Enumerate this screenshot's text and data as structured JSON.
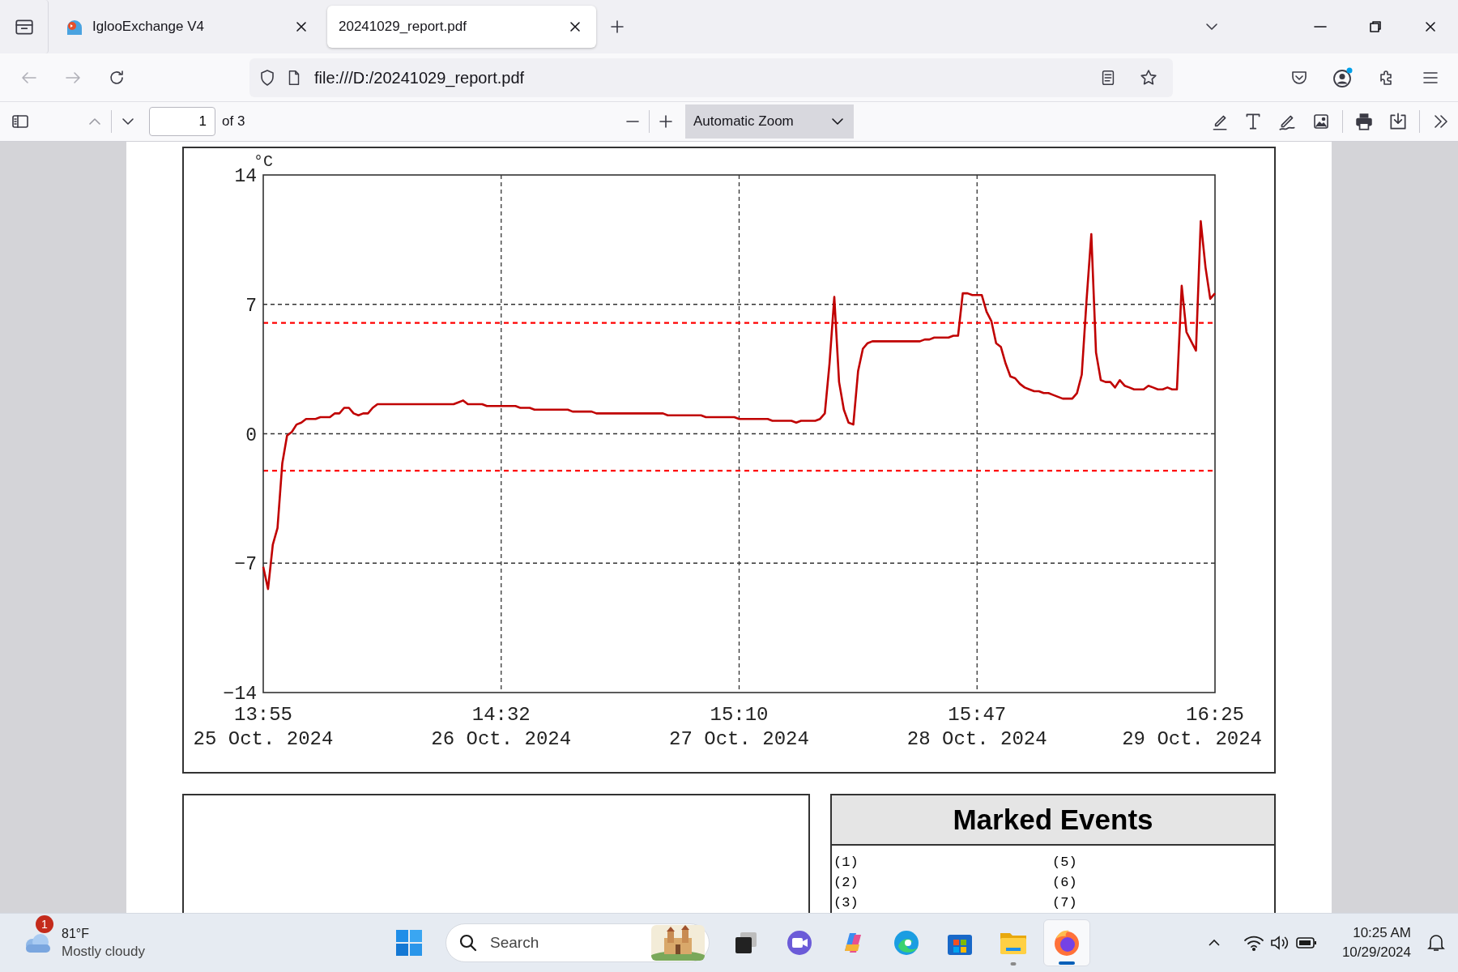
{
  "tabs": [
    {
      "kind": "igloo",
      "label": "IglooExchange V4",
      "selected": false
    },
    {
      "kind": "pdf",
      "label": "20241029_report.pdf",
      "selected": true
    }
  ],
  "address_bar": {
    "url": "file:///D:/20241029_report.pdf"
  },
  "nav": {
    "back_disabled": true,
    "forward_disabled": true
  },
  "pdf_toolbar": {
    "page": "1",
    "page_count": "of 3",
    "zoom": "Automatic Zoom"
  },
  "temperature_chart": {
    "chart_data": {
      "type": "line",
      "ylabel": "°C",
      "categories": [
        "13:55",
        null,
        null,
        null,
        null,
        null,
        null,
        null,
        null,
        null,
        null,
        null,
        null,
        null,
        null,
        null,
        null,
        null,
        null,
        null,
        null,
        null,
        null,
        null,
        null,
        null,
        null,
        null,
        null,
        null,
        null,
        null,
        null,
        null,
        null,
        null,
        null,
        null,
        null,
        null,
        null,
        null,
        null,
        null,
        null,
        null,
        null,
        null,
        null,
        null,
        "14:32",
        null,
        null,
        null,
        null,
        null,
        null,
        null,
        null,
        null,
        null,
        null,
        null,
        null,
        null,
        null,
        null,
        null,
        null,
        null,
        null,
        null,
        null,
        null,
        null,
        null,
        null,
        null,
        null,
        null,
        null,
        null,
        null,
        null,
        null,
        null,
        null,
        null,
        null,
        null,
        null,
        null,
        null,
        null,
        null,
        null,
        null,
        null,
        null,
        null,
        "15:10",
        null,
        null,
        null,
        null,
        null,
        null,
        null,
        null,
        null,
        null,
        null,
        null,
        null,
        null,
        null,
        null,
        null,
        null,
        null,
        null,
        null,
        null,
        null,
        null,
        null,
        null,
        null,
        null,
        null,
        null,
        null,
        null,
        null,
        null,
        null,
        null,
        null,
        null,
        null,
        null,
        null,
        null,
        null,
        null,
        null,
        null,
        null,
        null,
        null,
        "15:47",
        null,
        null,
        null,
        null,
        null,
        null,
        null,
        null,
        null,
        null,
        null,
        null,
        null,
        null,
        null,
        null,
        null,
        null,
        null,
        null,
        null,
        null,
        null,
        null,
        null,
        null,
        null,
        null,
        null,
        null,
        null,
        null,
        null,
        null,
        null,
        null,
        null,
        null,
        null,
        null,
        null,
        null,
        null,
        null,
        null,
        null,
        null,
        null,
        null,
        "16:25"
      ],
      "series": [
        {
          "color": "#c00000",
          "values": [
            -7.2,
            -8.4,
            -6.0,
            -5.1,
            -1.6,
            -0.1,
            0.1,
            0.5,
            0.6,
            0.8,
            0.8,
            0.8,
            0.9,
            0.9,
            0.9,
            1.1,
            1.1,
            1.4,
            1.4,
            1.1,
            1.0,
            1.1,
            1.1,
            1.4,
            1.6,
            1.6,
            1.6,
            1.6,
            1.6,
            1.6,
            1.6,
            1.6,
            1.6,
            1.6,
            1.6,
            1.6,
            1.6,
            1.6,
            1.6,
            1.6,
            1.6,
            1.7,
            1.8,
            1.6,
            1.6,
            1.6,
            1.6,
            1.5,
            1.5,
            1.5,
            1.5,
            1.5,
            1.5,
            1.5,
            1.4,
            1.4,
            1.4,
            1.3,
            1.3,
            1.3,
            1.3,
            1.3,
            1.3,
            1.3,
            1.3,
            1.2,
            1.2,
            1.2,
            1.2,
            1.2,
            1.1,
            1.1,
            1.1,
            1.1,
            1.1,
            1.1,
            1.1,
            1.1,
            1.1,
            1.1,
            1.1,
            1.1,
            1.1,
            1.1,
            1.1,
            1.0,
            1.0,
            1.0,
            1.0,
            1.0,
            1.0,
            1.0,
            1.0,
            0.9,
            0.9,
            0.9,
            0.9,
            0.9,
            0.9,
            0.9,
            0.8,
            0.8,
            0.8,
            0.8,
            0.8,
            0.8,
            0.8,
            0.7,
            0.7,
            0.7,
            0.7,
            0.7,
            0.6,
            0.7,
            0.7,
            0.7,
            0.7,
            0.8,
            1.1,
            3.8,
            7.4,
            2.8,
            1.3,
            0.6,
            0.5,
            3.4,
            4.6,
            4.9,
            5.0,
            5.0,
            5.0,
            5.0,
            5.0,
            5.0,
            5.0,
            5.0,
            5.0,
            5.0,
            5.0,
            5.1,
            5.1,
            5.2,
            5.2,
            5.2,
            5.2,
            5.3,
            5.3,
            7.6,
            7.6,
            7.5,
            7.5,
            7.5,
            6.6,
            6.1,
            4.9,
            4.7,
            3.8,
            3.1,
            3.0,
            2.7,
            2.5,
            2.4,
            2.3,
            2.3,
            2.2,
            2.2,
            2.1,
            2.0,
            1.9,
            1.9,
            1.9,
            2.2,
            3.2,
            7.2,
            10.8,
            4.4,
            2.9,
            2.8,
            2.8,
            2.5,
            2.9,
            2.6,
            2.5,
            2.4,
            2.4,
            2.4,
            2.6,
            2.5,
            2.4,
            2.4,
            2.5,
            2.4,
            2.4,
            8.0,
            5.5,
            5.0,
            4.5,
            11.5,
            9.0,
            7.3,
            7.6
          ]
        }
      ],
      "ylim": [
        -14,
        14
      ],
      "grid": true,
      "yticks": [
        {
          "value": -14,
          "label": "−14"
        },
        {
          "value": -7,
          "label": "−7"
        },
        {
          "value": 0,
          "label": "0"
        },
        {
          "value": 7,
          "label": "7"
        },
        {
          "value": 14,
          "label": "14"
        }
      ],
      "ref_lines": [
        {
          "axis": "y",
          "value": 6
        },
        {
          "axis": "y",
          "value": -2
        }
      ]
    },
    "date_labels": [
      "25 Oct. 2024",
      "26 Oct. 2024",
      "27 Oct. 2024",
      "28 Oct. 2024",
      "29 Oct. 2024"
    ]
  },
  "marked_events": {
    "title": "Marked Events",
    "columns": [
      [
        "(1)",
        "(2)",
        "(3)"
      ],
      [
        "(5)",
        "(6)",
        "(7)"
      ]
    ]
  },
  "taskbar": {
    "weather": {
      "badge": "1",
      "temperature": "81°F",
      "condition": "Mostly cloudy"
    },
    "search_placeholder": "Search",
    "apps": [
      {
        "kind": "start",
        "running": false,
        "active": false
      },
      {
        "kind": "search"
      },
      {
        "kind": "taskview",
        "running": false,
        "active": false
      },
      {
        "kind": "meet",
        "running": false,
        "active": false
      },
      {
        "kind": "copilot",
        "running": false,
        "active": false
      },
      {
        "kind": "edge",
        "running": false,
        "active": false
      },
      {
        "kind": "store",
        "running": false,
        "active": false
      },
      {
        "kind": "explorer",
        "running": true,
        "active": false
      },
      {
        "kind": "firefox",
        "running": true,
        "active": true
      }
    ],
    "time": "10:25 AM",
    "date": "10/29/2024"
  }
}
